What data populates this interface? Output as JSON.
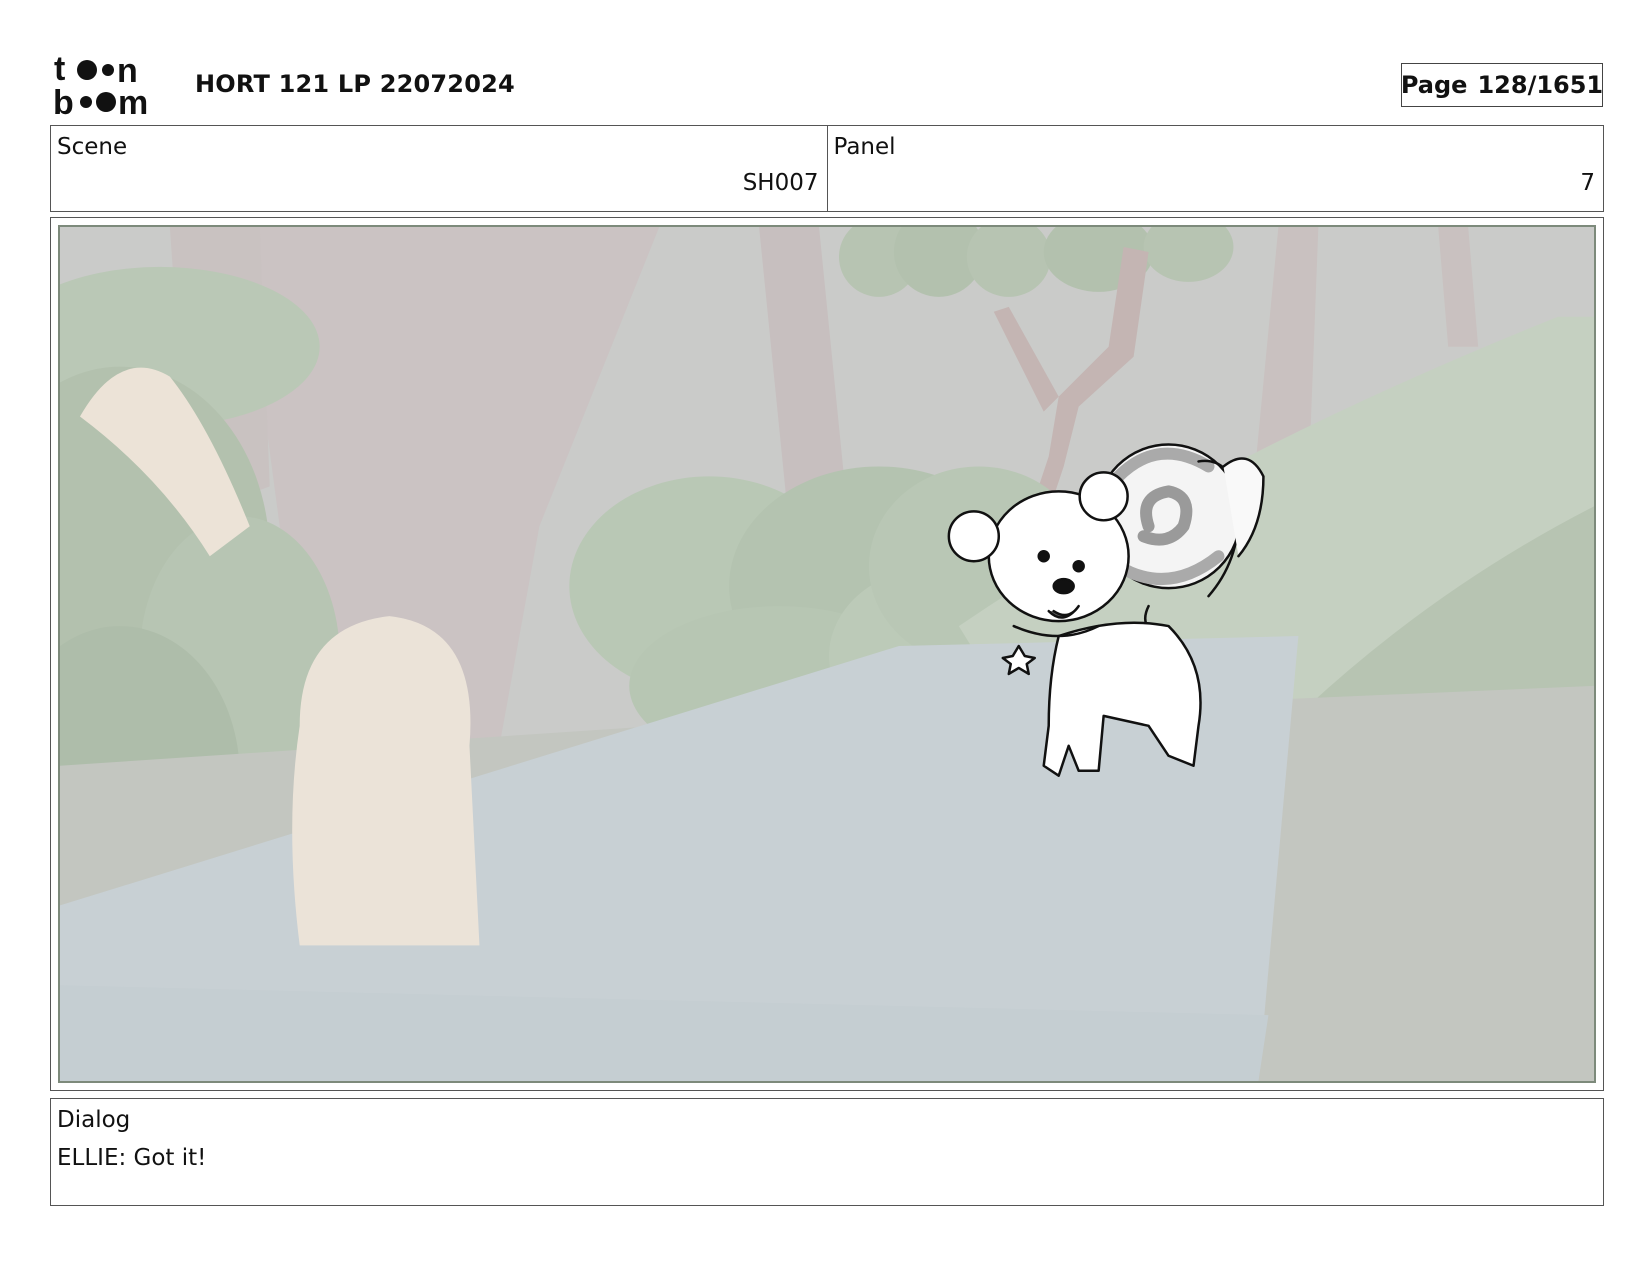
{
  "header": {
    "logo_icon": "toonboom-logo-icon",
    "title": "HORT 121 LP 22072024",
    "page_label": "Page",
    "page_value": "128/1651"
  },
  "info": {
    "scene_label": "Scene",
    "scene_value": "SH007",
    "panel_label": "Panel",
    "panel_value": "7"
  },
  "panel_image": {
    "icon": "storyboard-panel-image",
    "description_colors": {
      "foliage": "#b8c8b3",
      "ground": "#c3c6c0",
      "water": "#c9d2d6",
      "trunk": "#cdc4c4"
    }
  },
  "dialog": {
    "label": "Dialog",
    "text": "ELLIE: Got it!"
  }
}
